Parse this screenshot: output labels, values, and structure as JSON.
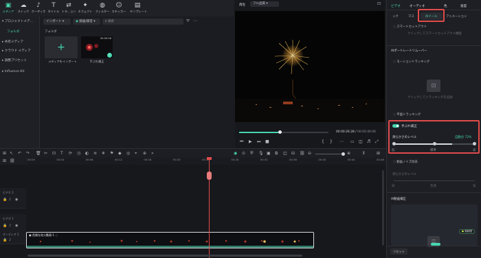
{
  "toolbar": {
    "items": [
      {
        "label": "メディア",
        "icon": "media-icon"
      },
      {
        "label": "ストック",
        "icon": "stock-icon"
      },
      {
        "label": "オーディオ",
        "icon": "audio-icon"
      },
      {
        "label": "タイトル",
        "icon": "title-icon"
      },
      {
        "label": "トラ…ョン",
        "icon": "transition-icon"
      },
      {
        "label": "エフェクト",
        "icon": "effect-icon"
      },
      {
        "label": "フィルター",
        "icon": "filter-icon"
      },
      {
        "label": "ステッカー",
        "icon": "sticker-icon"
      },
      {
        "label": "テンプレート",
        "icon": "template-icon"
      }
    ]
  },
  "sidebar": {
    "project_media": "プロジェクトメデ…",
    "folder": "フォルダ",
    "items": [
      "共有メディア",
      "クラウド メディア",
      "調整プリセット",
      "Influence Kit"
    ]
  },
  "media": {
    "import_label": "インポート",
    "record_label": "録画/録音",
    "search_placeholder": "検索",
    "folder_label": "フォルダ",
    "import_tile_label": "メディアをインポート",
    "clip_label": "手ぶれ補正",
    "clip_duration": "00:00:06"
  },
  "player": {
    "mode": "再生",
    "quality": "フル品質",
    "current_time": "00:00:26:28",
    "total_time": "00:00:46:06",
    "progress_fraction": 0.45
  },
  "right_panel": {
    "tabs": [
      "ビデオ",
      "オーディオ",
      "色",
      "速度"
    ],
    "subtabs": [
      "ック",
      "マス",
      "AIツール",
      "アニメーション"
    ],
    "smart_cutout": "スマートカットアウト",
    "smart_cutout_desc": "クリックしてスマートカットアウト機能",
    "ai_portrait": "AIポートレートリムーバー",
    "motion_tracking": "モーショントラッキング",
    "motion_tracking_desc": "クリックしてトラッキングを追加",
    "plane_tracking": "平面トラッキング",
    "stabilization": "手ぶれ補正",
    "smoothness_label": "滑らかさのレベル",
    "smoothness_value": "自動分 72%",
    "slider_low": "低",
    "slider_mid": "標準",
    "slider_high": "高",
    "smoothness_fraction": 0.72,
    "denoise": "動画ノイズ除去",
    "denoise_level": "滑らかさのレベル",
    "denoise_low": "弱",
    "denoise_mid": "普通",
    "denoise_high": "強",
    "ai_color": "AI動画補正",
    "unlimited_badge": "無制限",
    "reset_label": "リセット",
    "accent": "#47d6b0",
    "highlight": "#e14b4b"
  },
  "timeline": {
    "ticks": [
      "00:00",
      "00:04",
      "00:08",
      "00:12",
      "00:16",
      "00:20",
      "00:24",
      "00:28",
      "00:32",
      "00:36",
      "00:40",
      "00:44",
      "00:48"
    ],
    "tracks": [
      "ビデオ 2",
      "ビデオ 1",
      "オーディオ 1"
    ],
    "clip_title": "危険な花火動画-1",
    "playhead_fraction": 0.52
  }
}
